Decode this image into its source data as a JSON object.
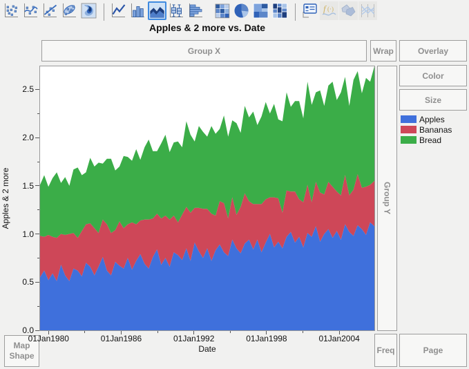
{
  "title": "Apples & 2 more vs. Date",
  "toolbar": {
    "groups": [
      [
        {
          "name": "points-icon"
        },
        {
          "name": "smoother-icon"
        },
        {
          "name": "line-of-fit-icon"
        },
        {
          "name": "ellipse-icon"
        },
        {
          "name": "contour-icon"
        }
      ],
      [
        {
          "name": "line-icon"
        },
        {
          "name": "bar-icon"
        },
        {
          "name": "area-icon",
          "selected": true
        },
        {
          "name": "box-plot-icon"
        },
        {
          "name": "histogram-icon"
        }
      ],
      [
        {
          "name": "heatmap-icon"
        },
        {
          "name": "pie-icon"
        },
        {
          "name": "treemap-icon"
        },
        {
          "name": "mosaic-icon"
        }
      ],
      [
        {
          "name": "caption-box-icon"
        },
        {
          "name": "formula-icon",
          "muted": true
        },
        {
          "name": "map-shapes-icon",
          "muted": true
        },
        {
          "name": "parallel-plot-icon",
          "muted": true
        }
      ]
    ]
  },
  "zones": {
    "group_x": "Group X",
    "wrap": "Wrap",
    "overlay": "Overlay",
    "color": "Color",
    "size": "Size",
    "group_y": "Group Y",
    "map_shape": "Map Shape",
    "freq": "Freq",
    "page": "Page"
  },
  "chart_data": {
    "type": "area",
    "stacked": true,
    "title": "Apples & 2 more vs. Date",
    "xlabel": "Date",
    "ylabel": "Apples & 2 more",
    "grid": false,
    "legend_position": "right",
    "ylim": [
      0,
      2.74
    ],
    "y_ticks": [
      0.0,
      0.5,
      1.0,
      1.5,
      2.0,
      2.5
    ],
    "y_minor_ticks": [
      0.25,
      0.75,
      1.25,
      1.75,
      2.25
    ],
    "xlim_years": [
      1979.3,
      2006.9
    ],
    "x_ticks": [
      {
        "label": "01Jan1980",
        "year": 1980
      },
      {
        "label": "01Jan1986",
        "year": 1986
      },
      {
        "label": "01Jan1992",
        "year": 1992
      },
      {
        "label": "01Jan1998",
        "year": 1998
      },
      {
        "label": "01Jan2004",
        "year": 2004
      }
    ],
    "x_minor_tick_years": [
      1983,
      1989,
      1995,
      2001
    ],
    "x_start_year": 1980,
    "x_step_years": 0.3333,
    "series": [
      {
        "name": "Apples",
        "color": "#3F70DC",
        "values": [
          0.55,
          0.62,
          0.52,
          0.59,
          0.51,
          0.68,
          0.57,
          0.51,
          0.64,
          0.62,
          0.56,
          0.7,
          0.66,
          0.57,
          0.66,
          0.76,
          0.62,
          0.57,
          0.71,
          0.67,
          0.64,
          0.75,
          0.63,
          0.72,
          0.79,
          0.69,
          0.64,
          0.76,
          0.84,
          0.68,
          0.75,
          0.66,
          0.81,
          0.78,
          0.73,
          0.85,
          0.72,
          0.91,
          0.82,
          0.75,
          0.85,
          0.72,
          0.83,
          0.89,
          0.81,
          0.77,
          0.94,
          0.85,
          0.8,
          0.9,
          0.94,
          0.84,
          0.94,
          0.81,
          0.91,
          1.0,
          0.86,
          0.92,
          0.85,
          0.97,
          1.02,
          0.91,
          0.97,
          0.86,
          1.01,
          0.97,
          1.08,
          0.92,
          1.0,
          1.05,
          0.96,
          1.03,
          0.94,
          1.1,
          1.02,
          0.98,
          1.09,
          1.05,
          0.99,
          1.12,
          1.08
        ]
      },
      {
        "name": "Bananas",
        "color": "#CE4758",
        "values": [
          0.43,
          0.35,
          0.47,
          0.38,
          0.45,
          0.32,
          0.42,
          0.49,
          0.37,
          0.34,
          0.47,
          0.4,
          0.45,
          0.49,
          0.35,
          0.39,
          0.48,
          0.44,
          0.33,
          0.46,
          0.42,
          0.35,
          0.49,
          0.38,
          0.35,
          0.46,
          0.51,
          0.4,
          0.37,
          0.48,
          0.44,
          0.49,
          0.38,
          0.34,
          0.47,
          0.43,
          0.5,
          0.36,
          0.45,
          0.51,
          0.41,
          0.49,
          0.36,
          0.45,
          0.51,
          0.39,
          0.44,
          0.35,
          0.48,
          0.52,
          0.4,
          0.47,
          0.37,
          0.5,
          0.45,
          0.38,
          0.52,
          0.45,
          0.37,
          0.48,
          0.42,
          0.53,
          0.39,
          0.47,
          0.5,
          0.36,
          0.46,
          0.51,
          0.41,
          0.49,
          0.53,
          0.41,
          0.46,
          0.51,
          0.38,
          0.48,
          0.53,
          0.43,
          0.5,
          0.39,
          0.47
        ]
      },
      {
        "name": "Bread",
        "color": "#3BAD48",
        "values": [
          0.53,
          0.64,
          0.5,
          0.61,
          0.68,
          0.53,
          0.6,
          0.5,
          0.66,
          0.73,
          0.58,
          0.54,
          0.68,
          0.64,
          0.73,
          0.58,
          0.68,
          0.77,
          0.62,
          0.57,
          0.75,
          0.7,
          0.64,
          0.78,
          0.63,
          0.75,
          0.83,
          0.7,
          0.65,
          0.78,
          0.84,
          0.7,
          0.76,
          0.84,
          0.7,
          0.89,
          0.81,
          0.69,
          0.85,
          0.8,
          0.75,
          0.91,
          0.85,
          0.75,
          0.91,
          0.85,
          0.8,
          0.95,
          0.77,
          0.91,
          0.87,
          0.96,
          0.82,
          0.91,
          1.01,
          0.87,
          0.97,
          0.82,
          0.95,
          1.02,
          0.88,
          0.94,
          1.02,
          0.87,
          1.07,
          1.01,
          0.93,
          1.06,
          0.92,
          1.0,
          1.09,
          0.95,
          1.07,
          1.02,
          0.93,
          1.14,
          1.07,
          0.98,
          1.13,
          1.07,
          1.19
        ]
      }
    ]
  }
}
